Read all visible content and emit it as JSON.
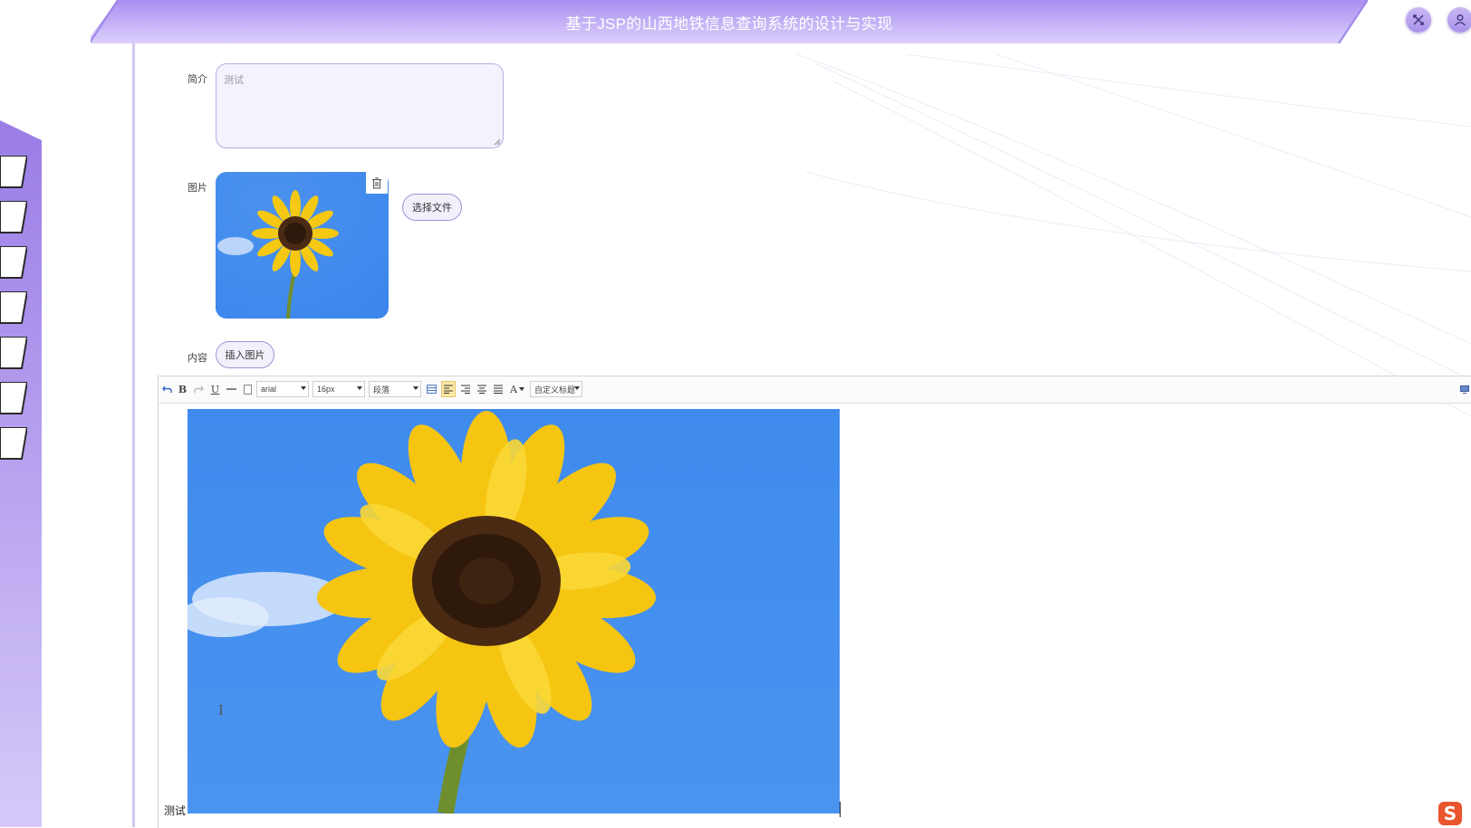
{
  "header": {
    "title": "基于JSP的山西地铁信息查询系统的设计与实现",
    "fullscreen_icon": "collapse-icon",
    "user_icon": "user-icon"
  },
  "sidebar": {
    "items": [
      "",
      "",
      "",
      "",
      "",
      "",
      ""
    ]
  },
  "form": {
    "intro_label": "简介",
    "intro_placeholder": "测试",
    "image_label": "图片",
    "choose_file_label": "选择文件",
    "content_label": "内容",
    "insert_image_label": "插入图片"
  },
  "editor": {
    "toolbar": {
      "undo_icon": "undo-icon",
      "bold": "B",
      "redo_icon": "redo-icon",
      "underline": "U",
      "hr_icon": "horizontal-rule-icon",
      "paste_icon": "paste-icon",
      "font_family": "arial",
      "font_size": "16px",
      "paragraph": "段落",
      "font_color": "A",
      "custom_title": "自定义标题"
    },
    "content_text": "测试"
  },
  "colors": {
    "header_gradient_start": "#b6a2f0",
    "header_gradient_end": "#d9ccfb",
    "accent": "#8f74e6",
    "sidebar": "#a78ae8"
  }
}
